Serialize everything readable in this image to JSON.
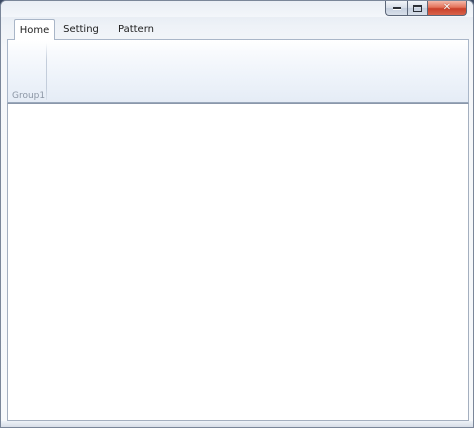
{
  "window": {
    "caption_buttons": {
      "minimize_icon": "minimize-icon",
      "maximize_icon": "maximize-icon",
      "close_icon": "close-icon",
      "close_glyph": "✕"
    }
  },
  "ribbon": {
    "tabs": [
      {
        "label": "Home",
        "active": true
      },
      {
        "label": "Setting",
        "active": false
      },
      {
        "label": "Pattern",
        "active": false
      }
    ],
    "groups": [
      {
        "label": "Group1"
      }
    ]
  },
  "colors": {
    "close_button": "#d9634b",
    "tab_border": "#a9b6c8",
    "group_label": "#8c96a5"
  }
}
